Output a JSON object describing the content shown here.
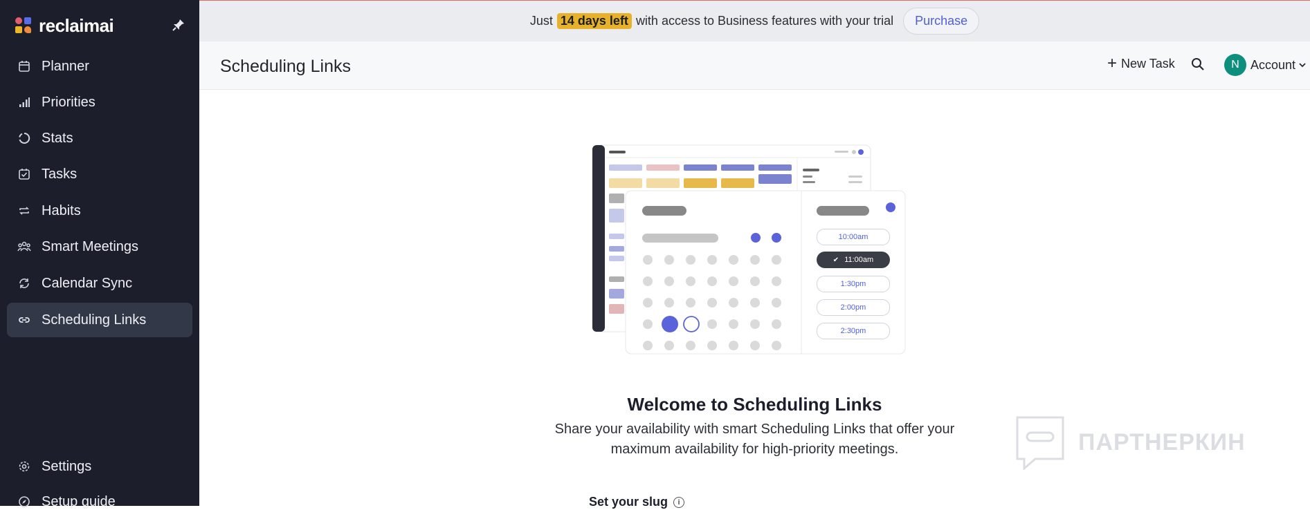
{
  "sidebar": {
    "brand": "reclaimai",
    "items": [
      {
        "label": "Planner",
        "icon": "calendar-icon"
      },
      {
        "label": "Priorities",
        "icon": "bar-chart-icon"
      },
      {
        "label": "Stats",
        "icon": "stats-ring-icon"
      },
      {
        "label": "Tasks",
        "icon": "checkbox-icon"
      },
      {
        "label": "Habits",
        "icon": "repeat-icon"
      },
      {
        "label": "Smart Meetings",
        "icon": "people-icon"
      },
      {
        "label": "Calendar Sync",
        "icon": "sync-icon"
      },
      {
        "label": "Scheduling Links",
        "icon": "link-icon",
        "active": true
      }
    ],
    "settings": "Settings",
    "setup_guide": "Setup guide"
  },
  "banner": {
    "prefix": "Just",
    "highlight": "14 days left",
    "suffix": "with access to Business features with your trial",
    "purchase": "Purchase"
  },
  "header": {
    "title": "Scheduling Links",
    "new_task": "New Task",
    "account": "Account",
    "avatar_initial": "N"
  },
  "illustration": {
    "times": [
      "10:00am",
      "11:00am",
      "1:30pm",
      "2:00pm",
      "2:30pm"
    ],
    "selected_time": "11:00am"
  },
  "welcome": {
    "title": "Welcome to Scheduling Links",
    "description": "Share your availability with smart Scheduling Links that offer your maximum availability for high-priority meetings.",
    "slug_label": "Set your slug"
  },
  "watermark": "ПАРТНЕРКИН",
  "colors": {
    "sidebar_bg": "#1c1f2b",
    "accent": "#4f5fd8",
    "highlight": "#e7b22a",
    "avatar": "#0e8f7e"
  }
}
